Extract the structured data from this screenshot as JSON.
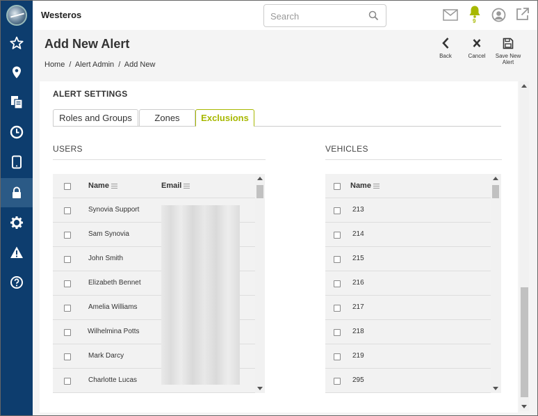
{
  "app": {
    "name": "Westeros"
  },
  "search": {
    "placeholder": "Search"
  },
  "notifications": {
    "count": "9"
  },
  "page": {
    "title": "Add New Alert",
    "breadcrumb": [
      "Home",
      "/",
      "Alert Admin",
      "/",
      "Add New"
    ]
  },
  "actions": {
    "back": "Back",
    "cancel": "Cancel",
    "save_line1": "Save New",
    "save_line2": "Alert"
  },
  "section": {
    "title": "ALERT SETTINGS"
  },
  "tabs": [
    {
      "label": "Roles and Groups"
    },
    {
      "label": "Zones"
    },
    {
      "label": "Exclusions",
      "active": true
    }
  ],
  "users": {
    "title": "USERS",
    "columns": {
      "name": "Name",
      "email": "Email"
    },
    "rows": [
      {
        "name": "Synovia Support"
      },
      {
        "name": "Sam Synovia"
      },
      {
        "name": "John Smith"
      },
      {
        "name": "Elizabeth Bennet"
      },
      {
        "name": "Amelia Williams"
      },
      {
        "name": "Wilhelmina Potts"
      },
      {
        "name": "Mark Darcy"
      },
      {
        "name": "Charlotte Lucas"
      }
    ]
  },
  "vehicles": {
    "title": "VEHICLES",
    "columns": {
      "name": "Name"
    },
    "rows": [
      {
        "name": "213"
      },
      {
        "name": "214"
      },
      {
        "name": "215"
      },
      {
        "name": "216"
      },
      {
        "name": "217"
      },
      {
        "name": "218"
      },
      {
        "name": "219"
      },
      {
        "name": "295"
      }
    ]
  },
  "icons": {
    "sidebar": [
      "star-icon",
      "map-pin-icon",
      "documents-icon",
      "clock-icon",
      "tablet-icon",
      "lock-icon",
      "gear-icon",
      "warning-icon",
      "help-icon"
    ],
    "top": [
      "search-icon",
      "mail-icon",
      "bell-icon",
      "user-icon",
      "external-link-icon"
    ],
    "accent_color": "#a7b800",
    "sidebar_color": "#0d3d6e"
  }
}
